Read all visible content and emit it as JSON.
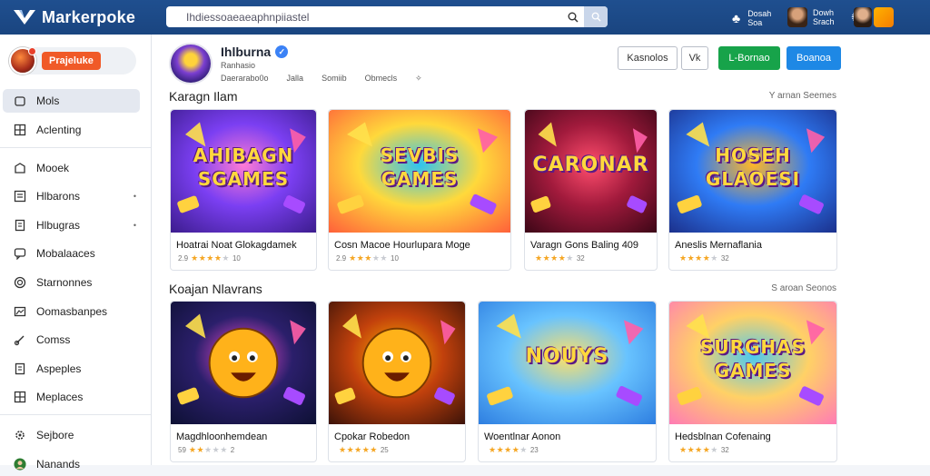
{
  "app": {
    "name": "Markerpoke"
  },
  "search": {
    "value": "Ihdiessoaeaeaphnpiiastel",
    "placeholder": ""
  },
  "top_users": [
    {
      "name": "Dosah",
      "sub": "Soa"
    },
    {
      "name": "Dowh",
      "sub": "Srach"
    }
  ],
  "sidebar": {
    "profile_label": "Prajeluke",
    "items": [
      {
        "label": "Mols",
        "icon": "home-icon",
        "active": true,
        "caret": false
      },
      {
        "label": "Aclenting",
        "icon": "grid-icon",
        "active": false,
        "caret": false
      },
      {
        "label": "Mooek",
        "icon": "store-icon",
        "active": false,
        "caret": false
      },
      {
        "label": "Hlbarons",
        "icon": "list-icon",
        "active": false,
        "caret": true
      },
      {
        "label": "Hlbugras",
        "icon": "doc-icon",
        "active": false,
        "caret": true
      },
      {
        "label": "Mobalaaces",
        "icon": "chat-icon",
        "active": false,
        "caret": false
      },
      {
        "label": "Starnonnes",
        "icon": "target-icon",
        "active": false,
        "caret": false
      },
      {
        "label": "Oomasbanpes",
        "icon": "image-icon",
        "active": false,
        "caret": false
      },
      {
        "label": "Comss",
        "icon": "link-icon",
        "active": false,
        "caret": false
      },
      {
        "label": "Aspeples",
        "icon": "doc-icon",
        "active": false,
        "caret": false
      },
      {
        "label": "Meplaces",
        "icon": "grid-icon",
        "active": false,
        "caret": false
      },
      {
        "label": "Sejbore",
        "icon": "settings-icon",
        "active": false,
        "caret": false
      },
      {
        "label": "Nanands",
        "icon": "avatar-icon",
        "active": false,
        "caret": false
      }
    ]
  },
  "channel": {
    "name": "Ihlburna",
    "sub1": "Ranhasio",
    "sub2": "Daerarabo0o",
    "meta": [
      "Jalla",
      "Somiib",
      "Obmecls"
    ]
  },
  "buttons": {
    "outline1": "Kasnolos",
    "outline2": "Vk",
    "green": "L-Bornao",
    "blue": "Boanoa"
  },
  "sections": [
    {
      "title": "Karagn Ilam",
      "link": "Y arnan Seemes",
      "cards": [
        {
          "title": "Hoatrai Noat Glokagdamek",
          "rating_a": "2.9",
          "rating_b": "10",
          "stars": 4,
          "thumb_text": [
            "AHIBAGN",
            "SGAMES"
          ],
          "theme": "purple"
        },
        {
          "title": "Cosn Macoe Hourlupara Moges",
          "rating_a": "2.9",
          "rating_b": "10",
          "stars": 3,
          "thumb_text": [
            "SEVBIS",
            "GAMES"
          ],
          "theme": "rainbow"
        },
        {
          "title": "Varagn Gons Baling 409",
          "rating_a": "",
          "rating_b": "32",
          "stars": 4,
          "thumb_text": [
            "CARONAR"
          ],
          "theme": "crimson"
        },
        {
          "title": "Aneslis Mernaflania",
          "rating_a": "",
          "rating_b": "32",
          "stars": 4,
          "thumb_text": [
            "HOSEH",
            "GLAOESI"
          ],
          "theme": "blue"
        }
      ]
    },
    {
      "title": "Koajan Nlavrans",
      "link": "S aroan Seonos",
      "cards": [
        {
          "title": "Magdhloonhemdean",
          "rating_a": "59",
          "rating_b": "2",
          "stars": 2,
          "thumb_text": [],
          "theme": "dark"
        },
        {
          "title": "Cpokar Robedon",
          "rating_a": "",
          "rating_b": "25",
          "stars": 5,
          "thumb_text": [],
          "theme": "orange"
        },
        {
          "title": "Woentlnar Aonon",
          "rating_a": "",
          "rating_b": "23",
          "stars": 4,
          "thumb_text": [
            "NOUYS"
          ],
          "theme": "sky"
        },
        {
          "title": "Hedsblnan Cofenaing",
          "rating_a": "",
          "rating_b": "32",
          "stars": 4,
          "thumb_text": [
            "SURGHAS",
            "GAMES"
          ],
          "theme": "rainbow2"
        }
      ]
    }
  ],
  "colors": {
    "topbar": "#1f4f8f",
    "green": "#17a34a",
    "blue": "#1e88e5",
    "accent": "#f05a28"
  }
}
